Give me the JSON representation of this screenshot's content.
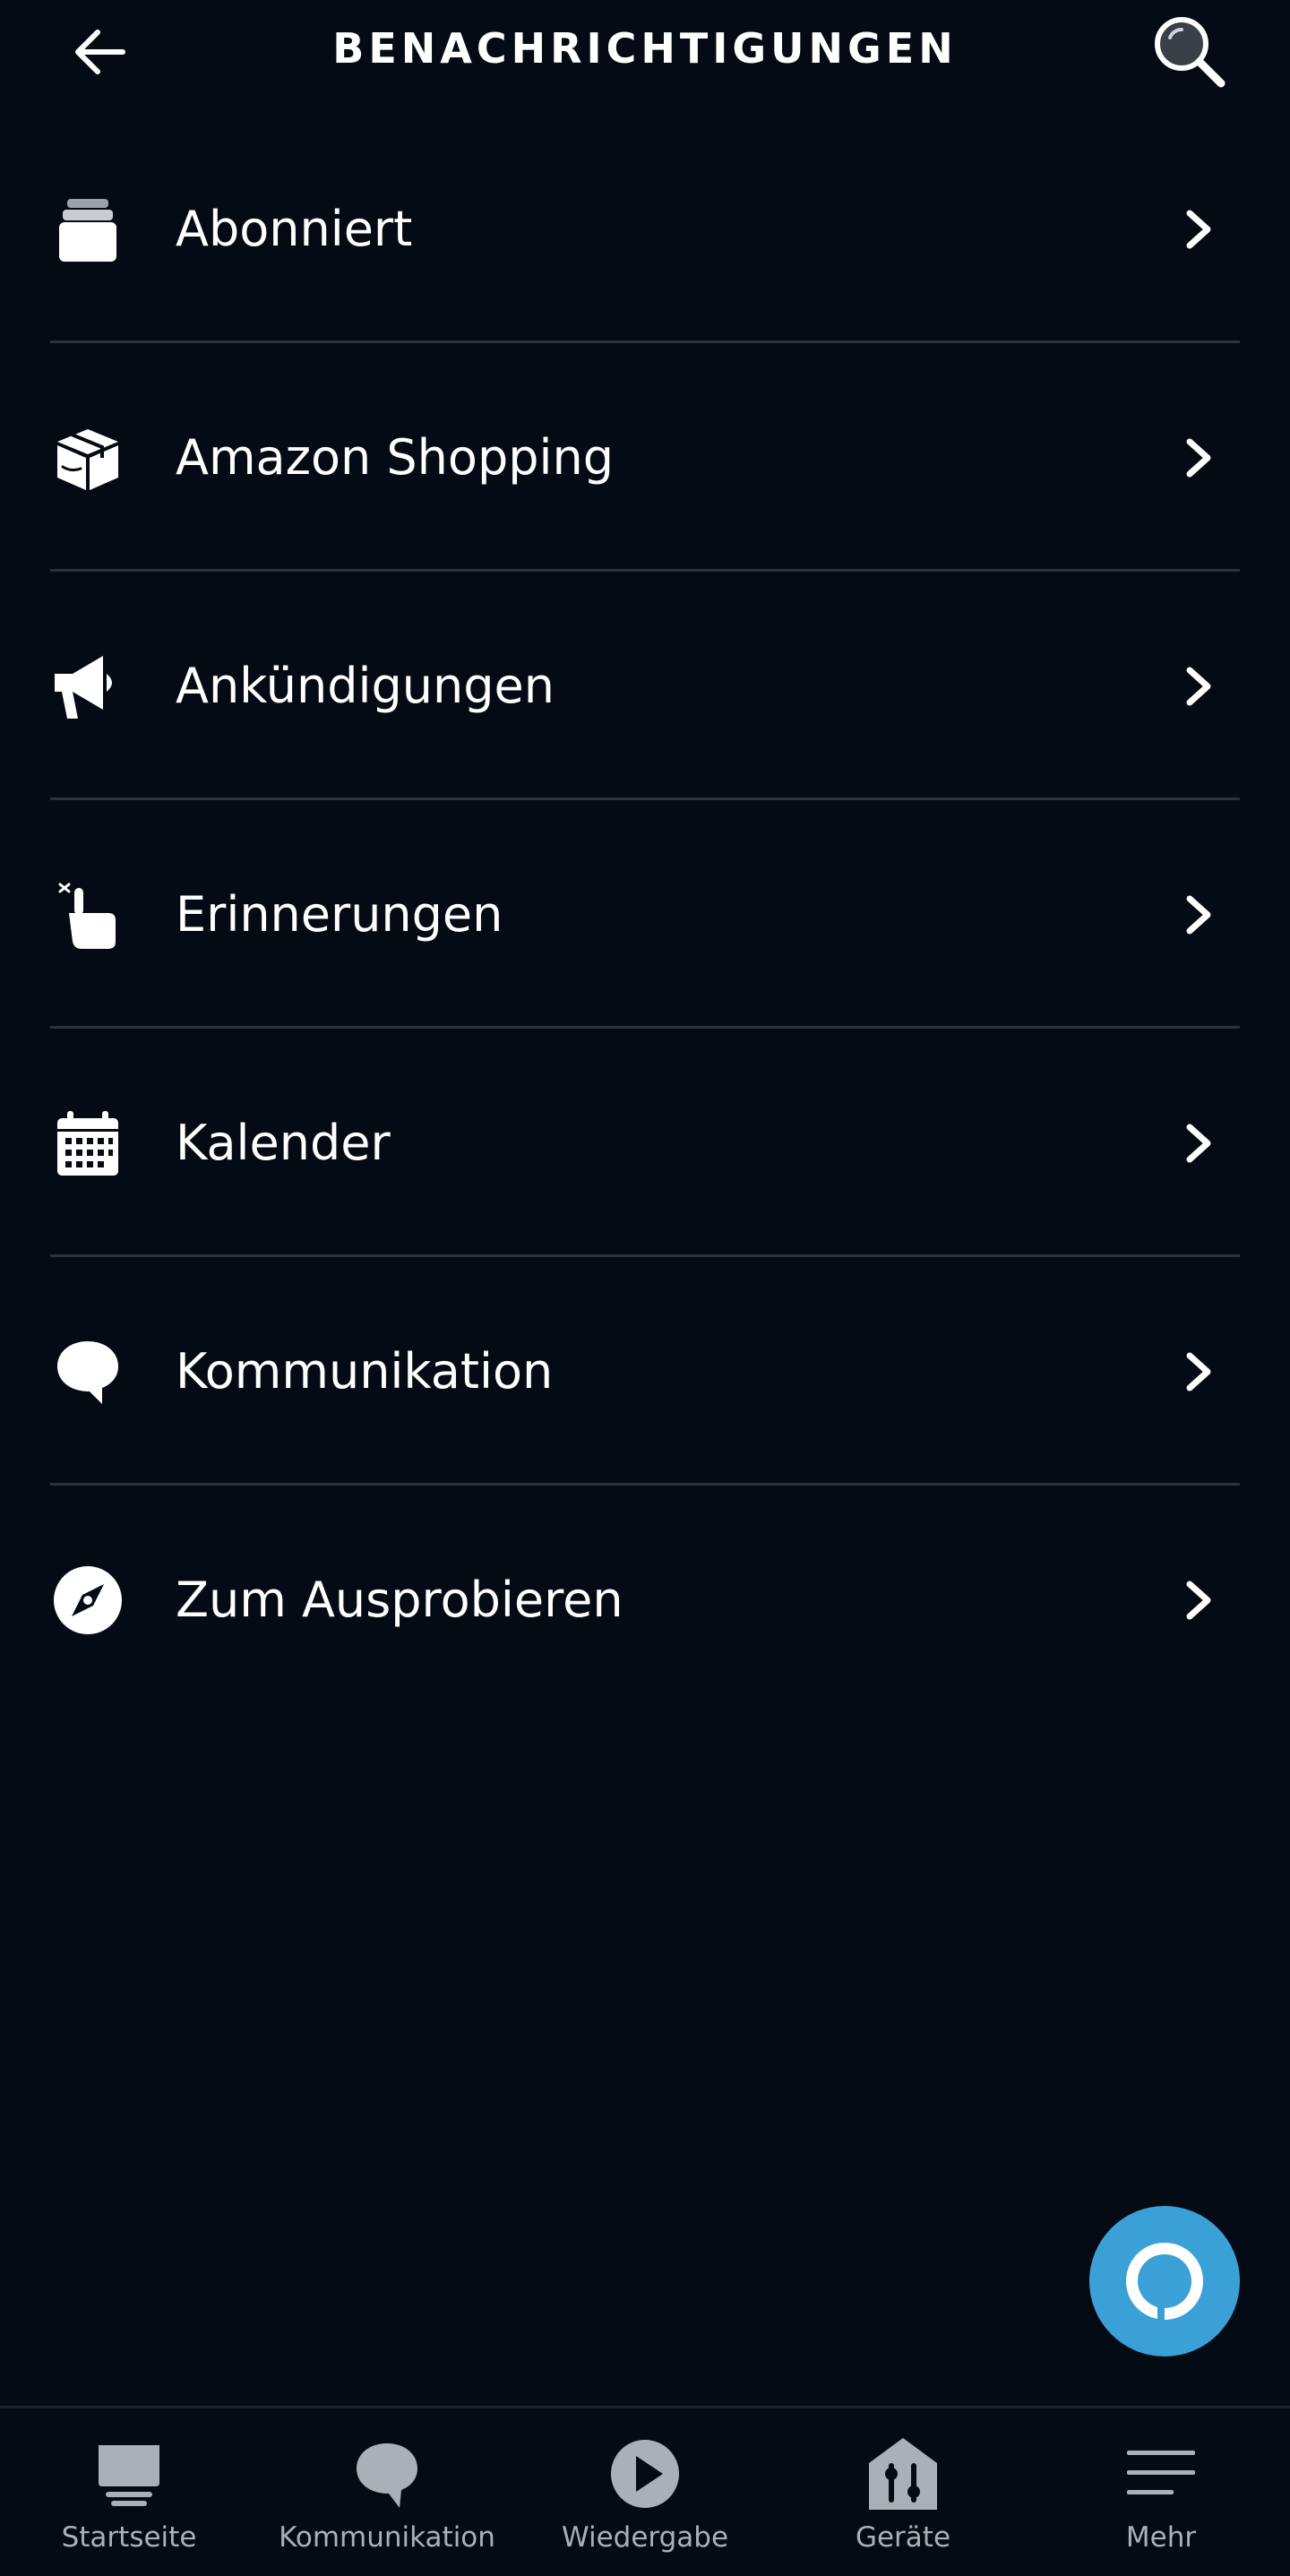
{
  "header": {
    "title": "BENACHRICHTIGUNGEN",
    "back_icon": "arrow-left-icon",
    "search_icon": "search-icon"
  },
  "menu": {
    "items": [
      {
        "label": "Abonniert",
        "icon": "subscribed-stack-icon"
      },
      {
        "label": "Amazon Shopping",
        "icon": "package-box-icon"
      },
      {
        "label": "Ankündigungen",
        "icon": "megaphone-icon"
      },
      {
        "label": "Erinnerungen",
        "icon": "hand-reminder-icon"
      },
      {
        "label": "Kalender",
        "icon": "calendar-icon"
      },
      {
        "label": "Kommunikation",
        "icon": "speech-bubble-icon"
      },
      {
        "label": "Zum Ausprobieren",
        "icon": "compass-icon"
      }
    ]
  },
  "alexa_button": {
    "icon": "alexa-ring-icon",
    "color": "#3aa0d6"
  },
  "bottom_nav": {
    "tabs": [
      {
        "label": "Startseite",
        "icon": "home-icon"
      },
      {
        "label": "Kommunikation",
        "icon": "chat-bubble-icon"
      },
      {
        "label": "Wiedergabe",
        "icon": "play-icon"
      },
      {
        "label": "Geräte",
        "icon": "devices-house-icon"
      },
      {
        "label": "Mehr",
        "icon": "menu-lines-icon"
      }
    ]
  },
  "colors": {
    "background": "#050b14",
    "divider": "#2a323c",
    "nav_inactive": "#aab0b8",
    "accent": "#3aa0d6"
  }
}
